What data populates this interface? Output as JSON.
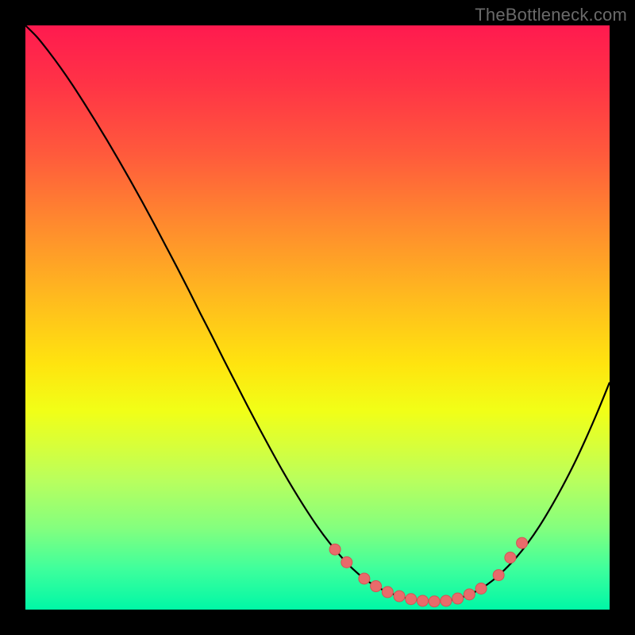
{
  "attribution": {
    "text": "TheBottleneck.com"
  },
  "colors": {
    "page_bg": "#000000",
    "curve": "#000000",
    "marker_fill": "#e86b6b",
    "marker_stroke": "#d35454",
    "gradient_stops": [
      "#ff1a4f",
      "#ff3346",
      "#ff5a3c",
      "#ff8a2e",
      "#ffb81f",
      "#ffe40f",
      "#f1ff17",
      "#d7ff3a",
      "#b8ff5e",
      "#84ff7e",
      "#3fff9c",
      "#00f7a6"
    ]
  },
  "chart_data": {
    "type": "line",
    "title": "",
    "xlabel": "",
    "ylabel": "",
    "xlim": [
      0,
      100
    ],
    "ylim": [
      0,
      100
    ],
    "x": [
      0,
      2,
      4,
      6,
      8,
      10,
      12,
      14,
      16,
      18,
      20,
      22,
      24,
      26,
      28,
      30,
      32,
      34,
      36,
      38,
      40,
      42,
      44,
      46,
      48,
      50,
      52,
      54,
      56,
      58,
      60,
      62,
      64,
      66,
      68,
      70,
      72,
      74,
      76,
      78,
      80,
      82,
      84,
      86,
      88,
      90,
      92,
      94,
      96,
      98,
      100
    ],
    "y": [
      100,
      98,
      95.5,
      92.8,
      89.9,
      86.8,
      83.6,
      80.3,
      76.9,
      73.4,
      69.8,
      66.1,
      62.3,
      58.5,
      54.6,
      50.6,
      46.7,
      42.7,
      38.8,
      34.9,
      31.1,
      27.4,
      23.8,
      20.4,
      17.2,
      14.2,
      11.5,
      9.1,
      7.0,
      5.3,
      4.0,
      3.0,
      2.3,
      1.8,
      1.5,
      1.4,
      1.5,
      1.9,
      2.6,
      3.6,
      5.0,
      6.8,
      8.9,
      11.4,
      14.3,
      17.6,
      21.2,
      25.1,
      29.4,
      34.0,
      38.9
    ],
    "markers": {
      "x": [
        53,
        55,
        58,
        60,
        62,
        64,
        66,
        68,
        70,
        72,
        74,
        76,
        78,
        81,
        83,
        85
      ],
      "y": [
        10.3,
        8.1,
        5.3,
        4.0,
        3.0,
        2.3,
        1.8,
        1.5,
        1.4,
        1.5,
        1.9,
        2.6,
        3.6,
        5.9,
        8.9,
        11.4
      ]
    }
  }
}
